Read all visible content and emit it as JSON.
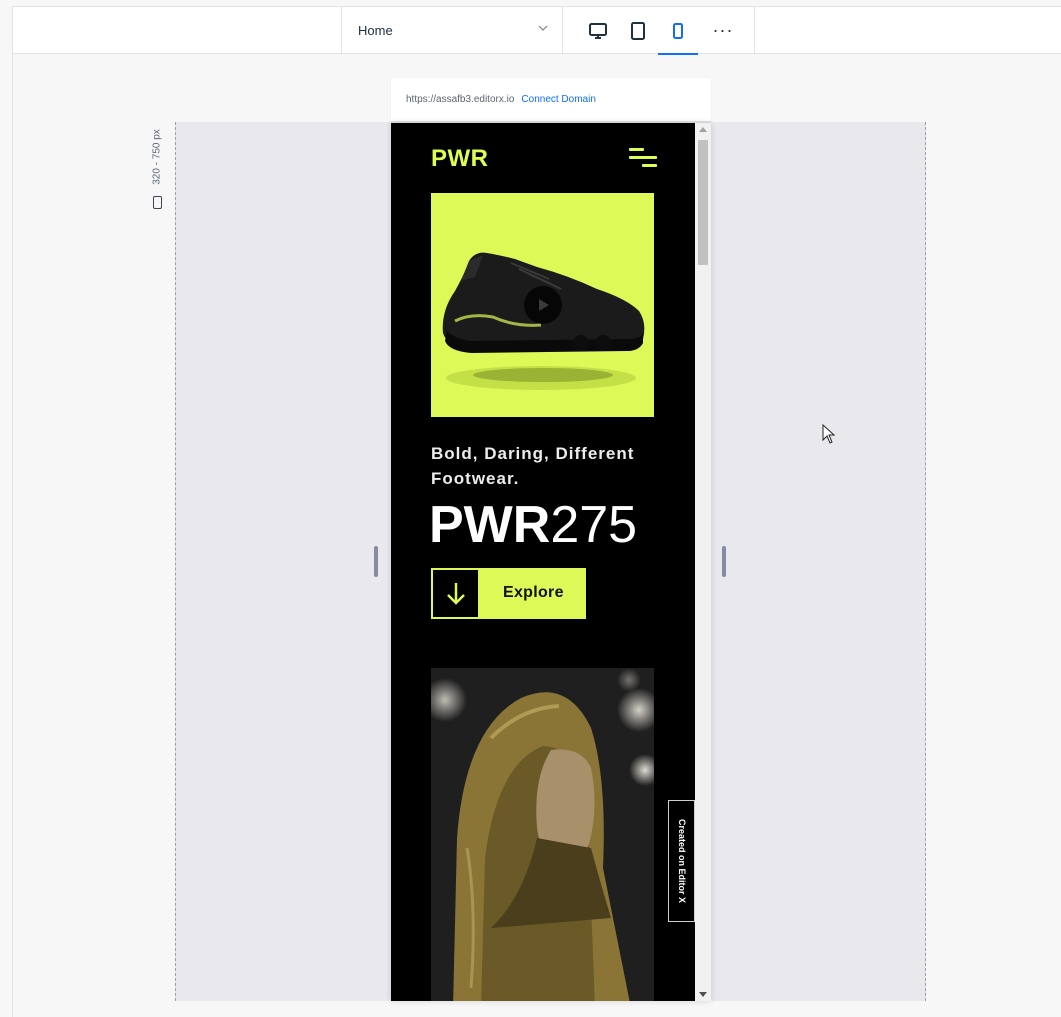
{
  "toolbar": {
    "page_select_value": "Home",
    "devices": [
      {
        "name": "desktop",
        "icon": "desktop-icon",
        "active": false
      },
      {
        "name": "tablet",
        "icon": "tablet-icon",
        "active": false
      },
      {
        "name": "mobile",
        "icon": "mobile-icon",
        "active": true
      }
    ],
    "more_label": "···",
    "accent_color": "#116dff"
  },
  "canvas": {
    "breakpoint_range": "320 - 750 px",
    "stage_color": "#e8e8ed"
  },
  "url_bar": {
    "url": "https://assafb3.editorx.io",
    "connect_label": "Connect Domain"
  },
  "site": {
    "logo": "PWR",
    "tagline": "Bold, Daring, Different Footwear.",
    "model_bold": "PWR",
    "model_light": "275",
    "cta_label": "Explore",
    "badge": "Created on Editor X",
    "brand_color": "#ddff55",
    "hero_bg_color": "#dcf957",
    "background_color": "#000000"
  }
}
